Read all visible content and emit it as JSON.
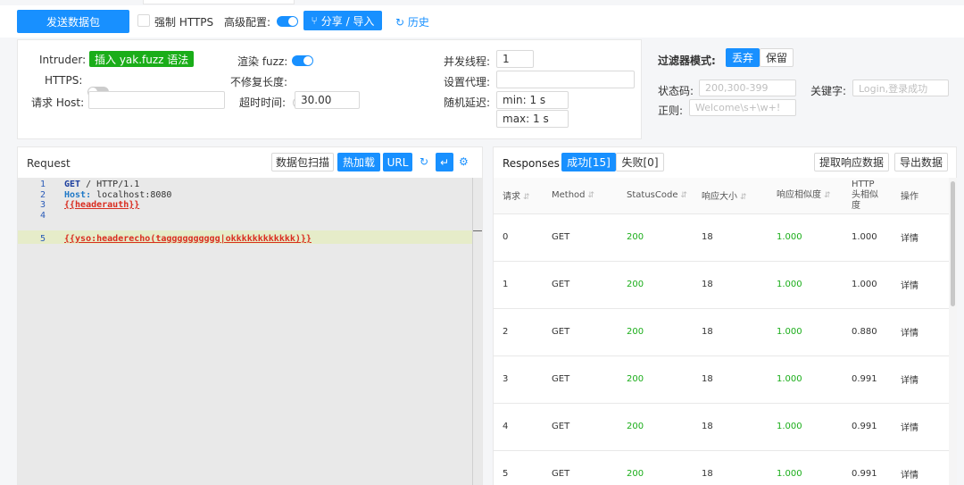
{
  "toolbar": {
    "send_button": "发送数据包",
    "force_https_label": "强制 HTTPS",
    "advanced_label": "高级配置:",
    "share_button": "分享 / 导入",
    "history_label": "历史"
  },
  "config": {
    "intruder_label": "Intruder:",
    "intruder_tag": "插入 yak.fuzz 语法",
    "render_fuzz_label": "渲染 fuzz:",
    "concurrency_label": "并发线程:",
    "concurrency_value": "1",
    "https_label": "HTTPS:",
    "no_fix_length_label": "不修复长度:",
    "proxy_label": "设置代理:",
    "proxy_value": "",
    "host_label": "请求 Host:",
    "host_value": "",
    "timeout_label": "超时时间:",
    "timeout_value": "30.00",
    "random_delay_label": "随机延迟:",
    "delay_min": "min: 1 s",
    "delay_max": "max: 1 s"
  },
  "filter": {
    "mode_label": "过滤器模式:",
    "discard_button": "丢弃",
    "keep_button": "保留",
    "status_label": "状态码:",
    "status_placeholder": "200,300-399",
    "keyword_label": "关键字:",
    "keyword_placeholder": "Login,登录成功",
    "regex_label": "正则:",
    "regex_placeholder": "Welcome\\s+\\w+!"
  },
  "request": {
    "title": "Request",
    "scan_button": "数据包扫描",
    "hotload_button": "热加载",
    "url_button": "URL",
    "lines": [
      {
        "num": "1",
        "parts": [
          {
            "cls": "kw",
            "text": "GET"
          },
          {
            "cls": "",
            "text": " / HTTP/1.1"
          }
        ]
      },
      {
        "num": "2",
        "parts": [
          {
            "cls": "hdr",
            "text": "Host:"
          },
          {
            "cls": "",
            "text": " localhost:8080"
          }
        ]
      },
      {
        "num": "3",
        "parts": [
          {
            "cls": "tpl",
            "text": "{{headerauth}}"
          }
        ]
      },
      {
        "num": "4",
        "parts": []
      },
      {
        "num": "5",
        "parts": [
          {
            "cls": "tpl",
            "text": "{{yso:headerecho(tagggggggggg|okkkkkkkkkkkk)}}"
          }
        ]
      }
    ]
  },
  "responses": {
    "title": "Responses",
    "success_tab": "成功[15]",
    "fail_tab": "失败[0]",
    "extract_button": "提取响应数据",
    "export_button": "导出数据",
    "columns": [
      "请求",
      "Method",
      "StatusCode",
      "响应大小",
      "响应相似度",
      "HTTP头相似度",
      "操作"
    ],
    "rows": [
      {
        "id": "0",
        "method": "GET",
        "status": "200",
        "size": "18",
        "sim": "1.000",
        "hsim": "1.000",
        "action": "详情"
      },
      {
        "id": "1",
        "method": "GET",
        "status": "200",
        "size": "18",
        "sim": "1.000",
        "hsim": "1.000",
        "action": "详情"
      },
      {
        "id": "2",
        "method": "GET",
        "status": "200",
        "size": "18",
        "sim": "1.000",
        "hsim": "0.880",
        "action": "详情"
      },
      {
        "id": "3",
        "method": "GET",
        "status": "200",
        "size": "18",
        "sim": "1.000",
        "hsim": "0.991",
        "action": "详情"
      },
      {
        "id": "4",
        "method": "GET",
        "status": "200",
        "size": "18",
        "sim": "1.000",
        "hsim": "0.991",
        "action": "详情"
      },
      {
        "id": "5",
        "method": "GET",
        "status": "200",
        "size": "18",
        "sim": "1.000",
        "hsim": "0.991",
        "action": "详情"
      }
    ]
  },
  "colors": {
    "primary": "#1890ff",
    "green": "#1aad19",
    "template_red": "#d92d20"
  }
}
